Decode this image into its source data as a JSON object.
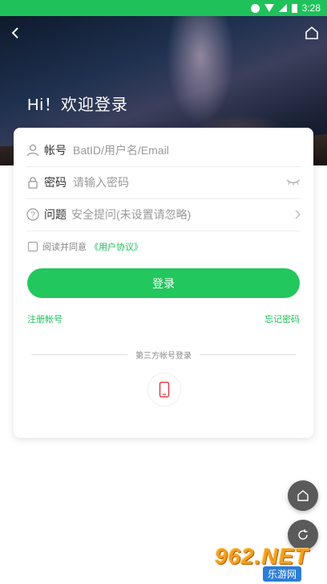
{
  "status_bar": {
    "time": "3:28"
  },
  "header": {
    "greeting": "Hi！欢迎登录",
    "back_icon": "chevron-left-icon",
    "home_icon": "home-icon"
  },
  "form": {
    "account_label": "帐号",
    "account_placeholder": "BatID/用户名/Email",
    "password_label": "密码",
    "password_placeholder": "请输入密码",
    "question_label": "问题",
    "question_placeholder": "安全提问(未设置请忽略)",
    "agree_text": "阅读并同意",
    "agree_link": "《用户协议》",
    "login_button": "登录",
    "register_link": "注册帐号",
    "forgot_link": "忘记密码",
    "third_party_label": "第三方帐号登录"
  },
  "floating": {
    "home_icon": "home-icon",
    "refresh_icon": "refresh-icon"
  },
  "watermark": {
    "big": "962.NET",
    "small": "乐游网"
  },
  "colors": {
    "accent": "#22c75d",
    "status_bar": "#1fc25a"
  }
}
